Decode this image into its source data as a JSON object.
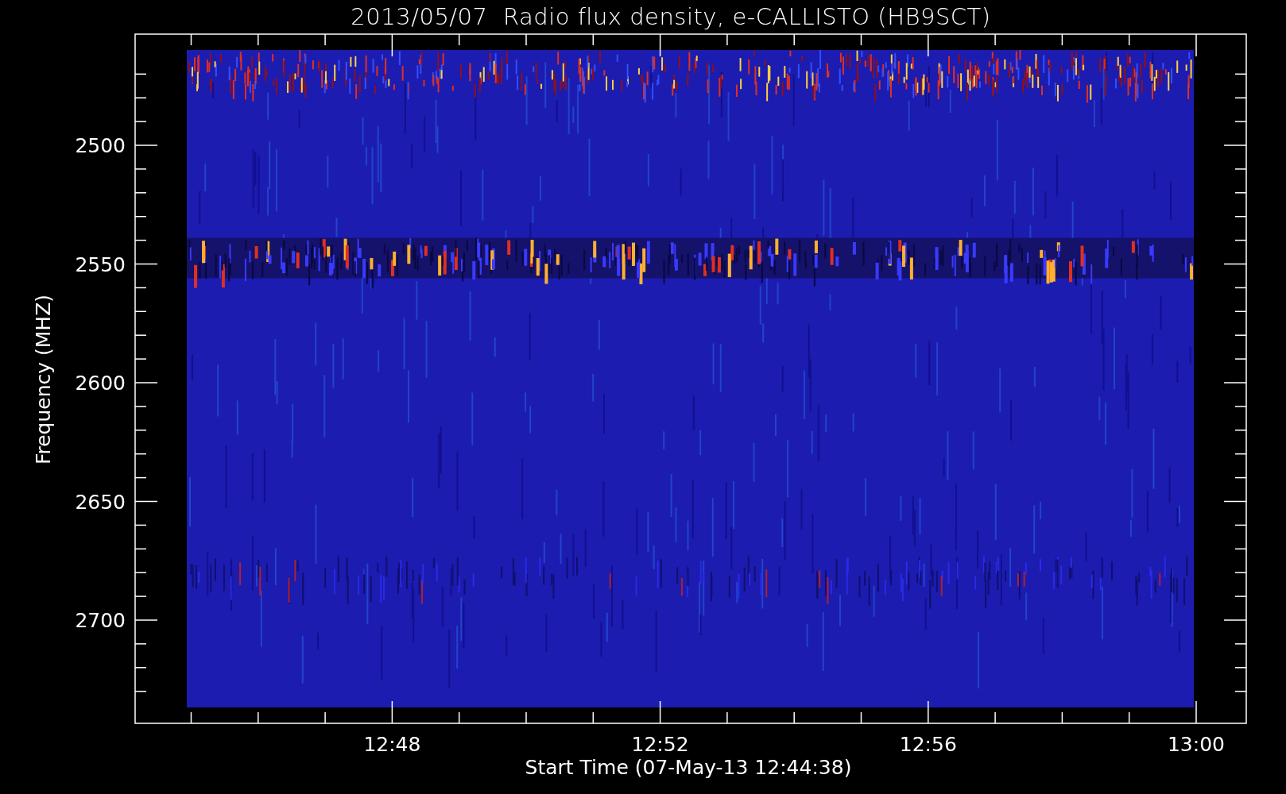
{
  "title": "2013/05/07  Radio flux density, e-CALLISTO (HB9SCT)",
  "y_axis": {
    "label": "Frequency (MHZ)",
    "ticks": [
      "2500",
      "2550",
      "2600",
      "2650",
      "2700"
    ]
  },
  "x_axis": {
    "label": "Start Time (07-May-13 12:44:38)",
    "ticks": [
      "12:48",
      "12:52",
      "12:56",
      "13:00"
    ]
  }
}
